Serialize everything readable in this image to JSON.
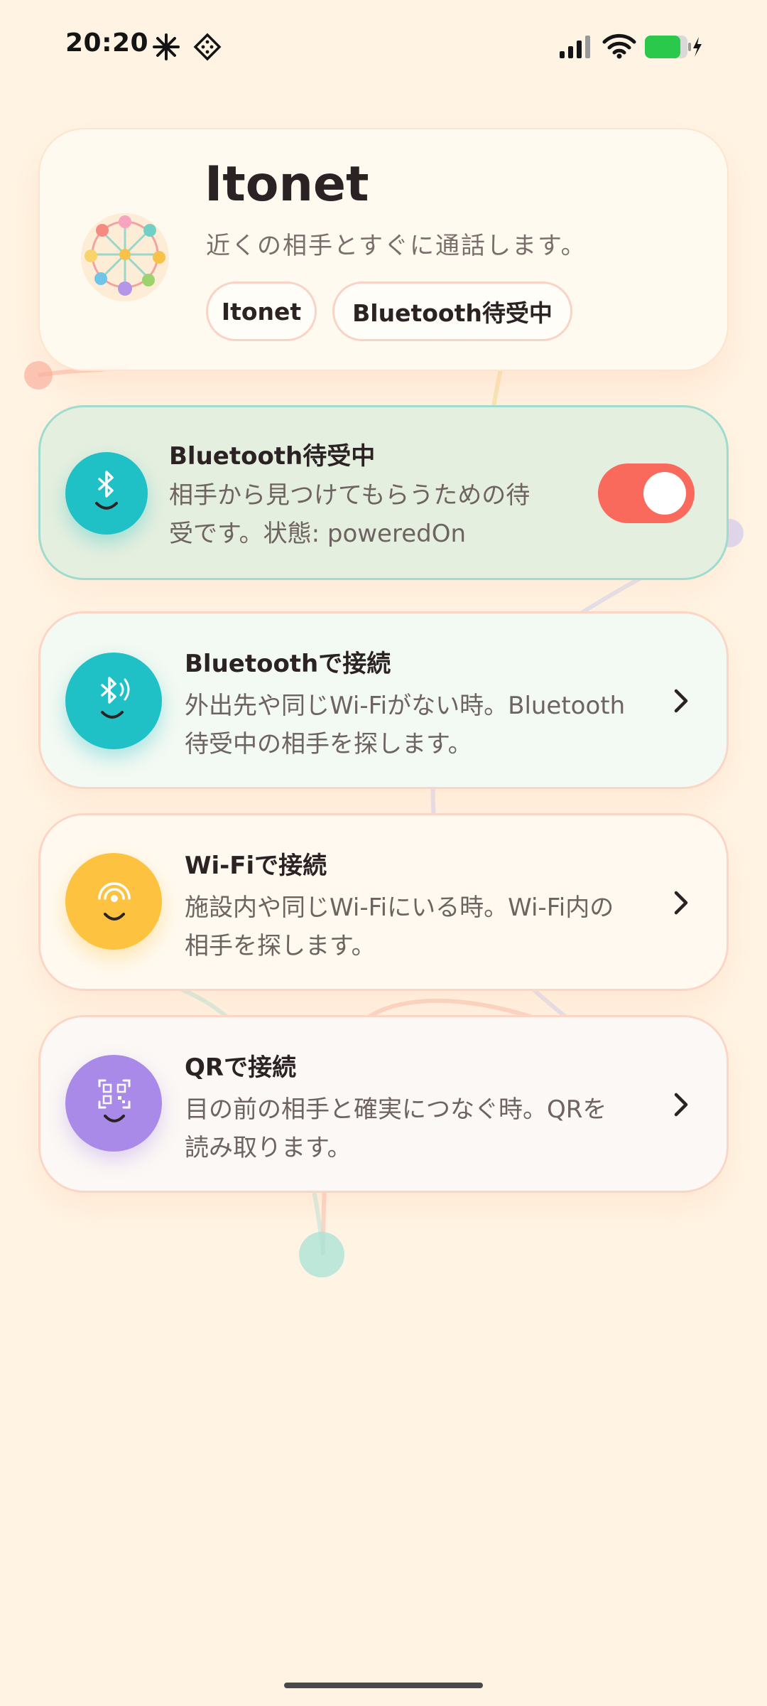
{
  "status_bar": {
    "time": "20:20",
    "left_icons": [
      "sparkle-icon",
      "dice-icon"
    ],
    "right_icons": [
      "cellular-signal-icon",
      "wifi-icon",
      "battery-charging-icon"
    ]
  },
  "header": {
    "title": "Itonet",
    "subtitle": "近くの相手とすぐに通話します。",
    "chips": [
      "Itonet",
      "Bluetooth待受中"
    ],
    "logo_icon": "ferris-wheel-logo-icon"
  },
  "standby_card": {
    "title": "Bluetooth待受中",
    "description_line1": "相手から見つけてもらうための待",
    "description_line2": "受です。状態: poweredOn",
    "icon": "bluetooth-smile-icon",
    "toggle_on": true,
    "accent_color": "#1fc1c6",
    "toggle_color": "#fa6a5c"
  },
  "connect_options": [
    {
      "title": "Bluetoothで接続",
      "description_line1": "外出先や同じWi-Fiがない時。Bluetooth",
      "description_line2": "待受中の相手を探します。",
      "icon": "bluetooth-signal-icon",
      "color": "#1fc1c6"
    },
    {
      "title": "Wi-Fiで接続",
      "description_line1": "施設内や同じWi-Fiにいる時。Wi-Fi内の",
      "description_line2": "相手を探します。",
      "icon": "wifi-signal-icon",
      "color": "#fdc23f"
    },
    {
      "title": "QRで接続",
      "description_line1": "目の前の相手と確実につなぐ時。QRを",
      "description_line2": "読み取ります。",
      "icon": "qr-code-icon",
      "color": "#a98ae8"
    }
  ]
}
